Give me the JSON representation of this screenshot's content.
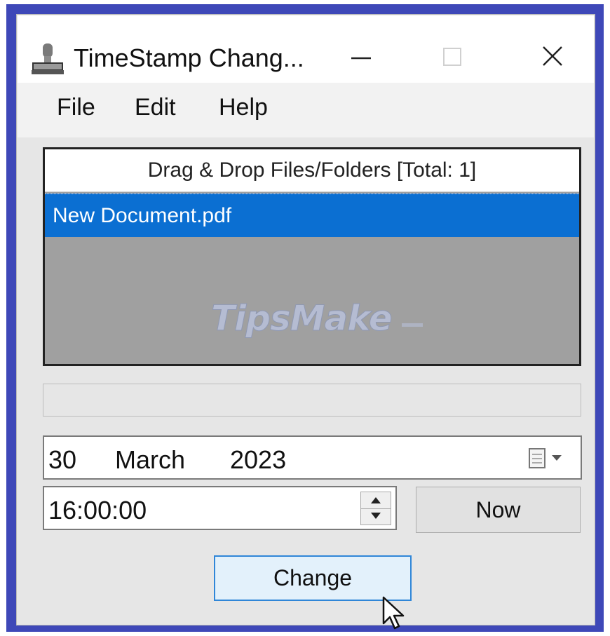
{
  "window": {
    "title": "TimeStamp Chang...",
    "icon": "stamp-icon",
    "controls": [
      "minimize-icon",
      "maximize-icon",
      "close-icon"
    ]
  },
  "menu": {
    "file": "File",
    "edit": "Edit",
    "help": "Help"
  },
  "file_list": {
    "header": "Drag & Drop Files/Folders [Total: 1]",
    "items": [
      "New Document.pdf"
    ],
    "selected_color": "#0b6fd2",
    "watermark": "TipsMake"
  },
  "progress": {
    "value": 0
  },
  "date": {
    "day": "30",
    "month": "March",
    "year": "2023",
    "icon": "calendar-dropdown-icon"
  },
  "time": {
    "value": "16:00:00",
    "icons": [
      "spin-up-icon",
      "spin-down-icon"
    ]
  },
  "buttons": {
    "now": "Now",
    "change": "Change"
  },
  "colors": {
    "frame": "#3e48b8",
    "window_bg": "#e6e6e6",
    "accent": "#2f86d8"
  }
}
